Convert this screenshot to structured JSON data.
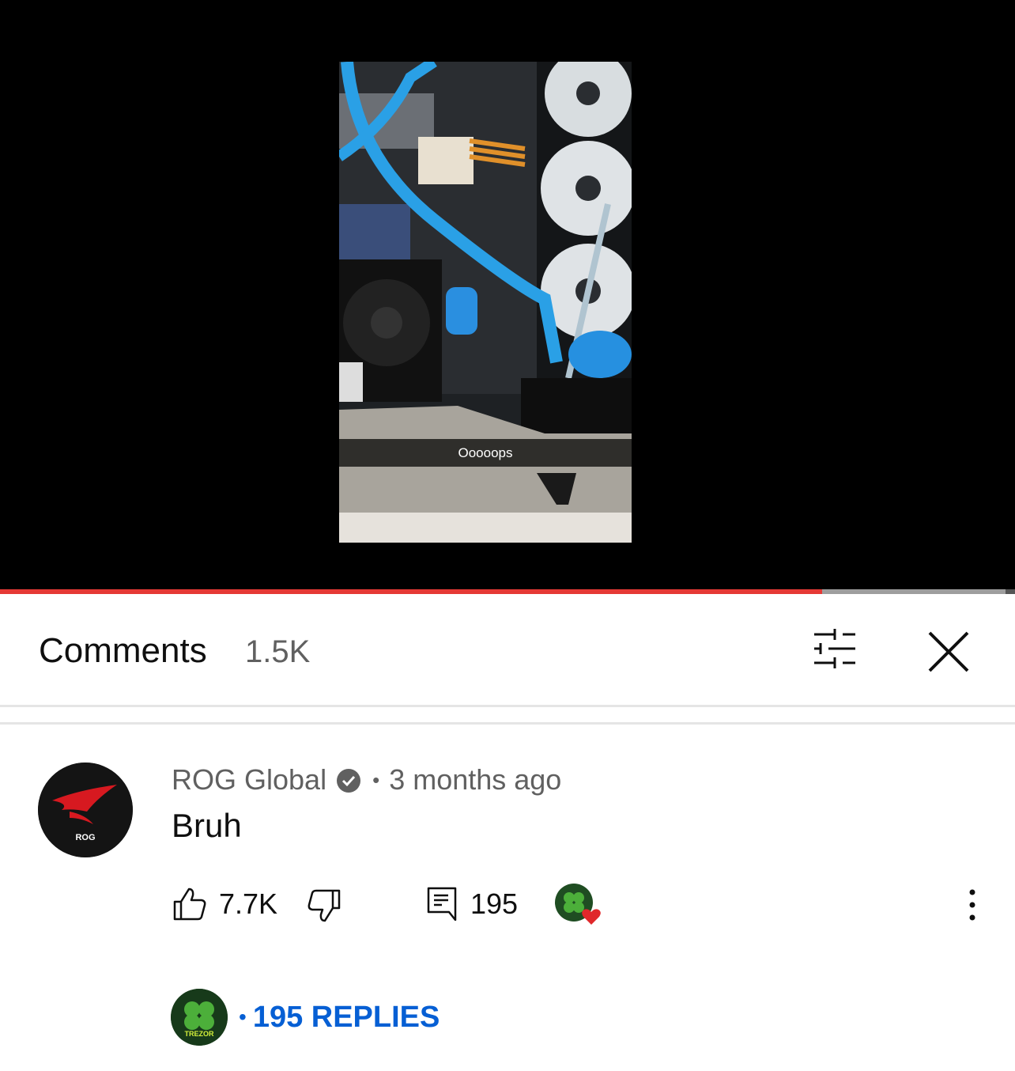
{
  "video": {
    "caption": "Ooooops",
    "progress_fraction": 0.81
  },
  "comments_panel": {
    "title": "Comments",
    "count": "1.5K",
    "filter_icon": "sliders-icon",
    "close_icon": "close-icon"
  },
  "comment": {
    "author": "ROG Global",
    "verified": true,
    "time_ago": "3 months ago",
    "text": "Bruh",
    "like_count": "7.7K",
    "reply_count": "195",
    "avatar_text": "ROG",
    "creator_heart": true
  },
  "replies": {
    "label": "195 REPLIES",
    "avatar_text": "TREZOR"
  },
  "colors": {
    "progress": "#e53935",
    "link": "#065fd4",
    "heart": "#e0282b",
    "rog_red": "#d71920"
  }
}
